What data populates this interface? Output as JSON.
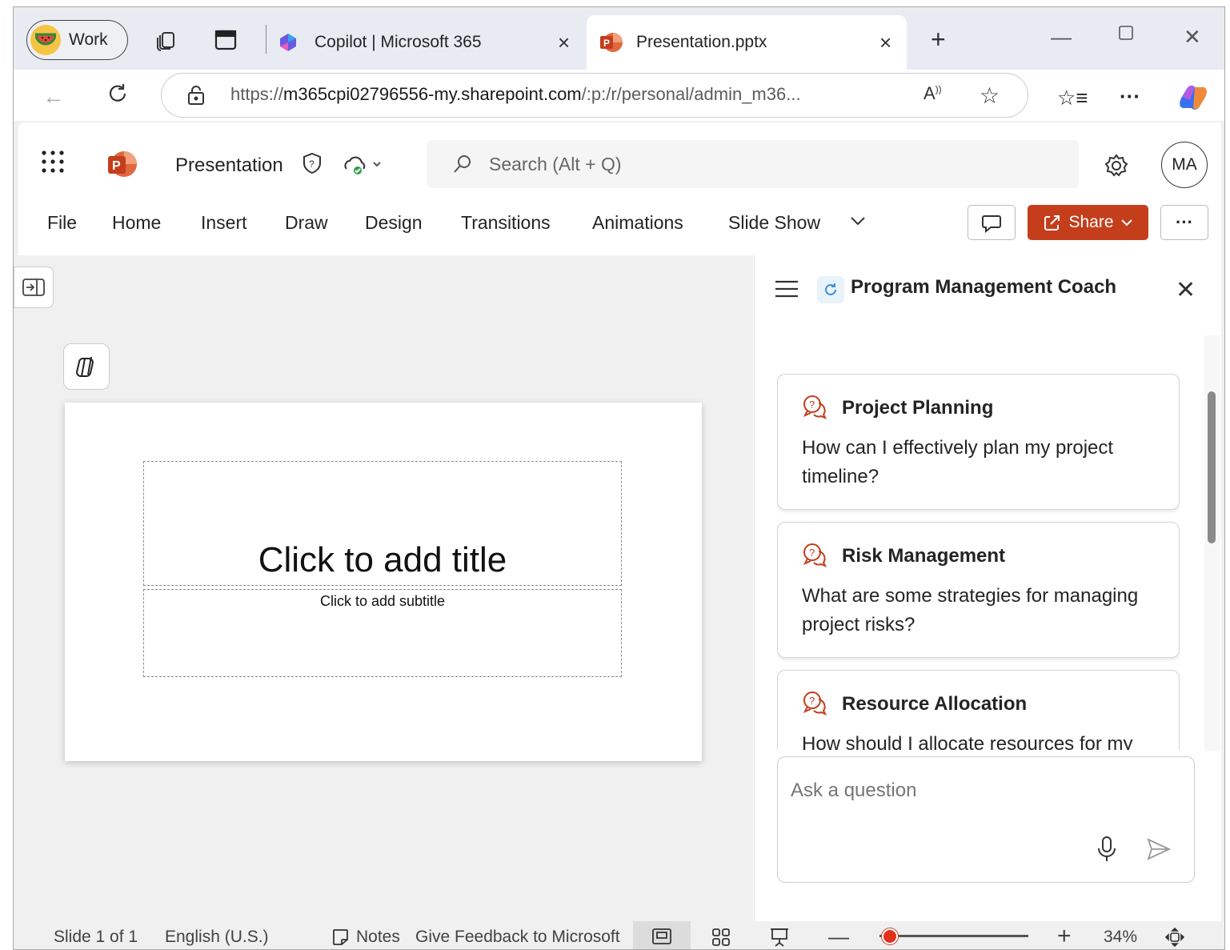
{
  "browser": {
    "profile_label": "Work",
    "tabs": [
      {
        "title": "Copilot | Microsoft 365"
      },
      {
        "title": "Presentation.pptx"
      }
    ],
    "address": {
      "prefix": "https://",
      "host": "m365cpi02796556-my.sharepoint.com",
      "path": "/:p:/r/personal/admin_m36..."
    }
  },
  "app": {
    "doc_title": "Presentation",
    "search_placeholder": "Search (Alt + Q)",
    "avatar_initials": "MA",
    "menu": [
      "File",
      "Home",
      "Insert",
      "Draw",
      "Design",
      "Transitions",
      "Animations",
      "Slide Show"
    ],
    "share_label": "Share",
    "more_label": "···"
  },
  "slide": {
    "title_placeholder": "Click to add title",
    "subtitle_placeholder": "Click to add subtitle"
  },
  "pane": {
    "title": "Program Management Coach",
    "cards": [
      {
        "title": "Project Planning",
        "body": "How can I effectively plan my project timeline?"
      },
      {
        "title": "Risk Management",
        "body": "What are some strategies for managing project risks?"
      },
      {
        "title": "Resource Allocation",
        "body": "How should I allocate resources for my"
      }
    ],
    "ask_placeholder": "Ask a question"
  },
  "statusbar": {
    "slide_info": "Slide 1 of 1",
    "language": "English (U.S.)",
    "notes": "Notes",
    "feedback": "Give Feedback to Microsoft",
    "zoom": "34%",
    "zoom_fraction": 0.07
  },
  "colors": {
    "accent": "#c43e1c",
    "tabstrip": "#e8ecf2",
    "canvas": "#f0f0f0"
  }
}
